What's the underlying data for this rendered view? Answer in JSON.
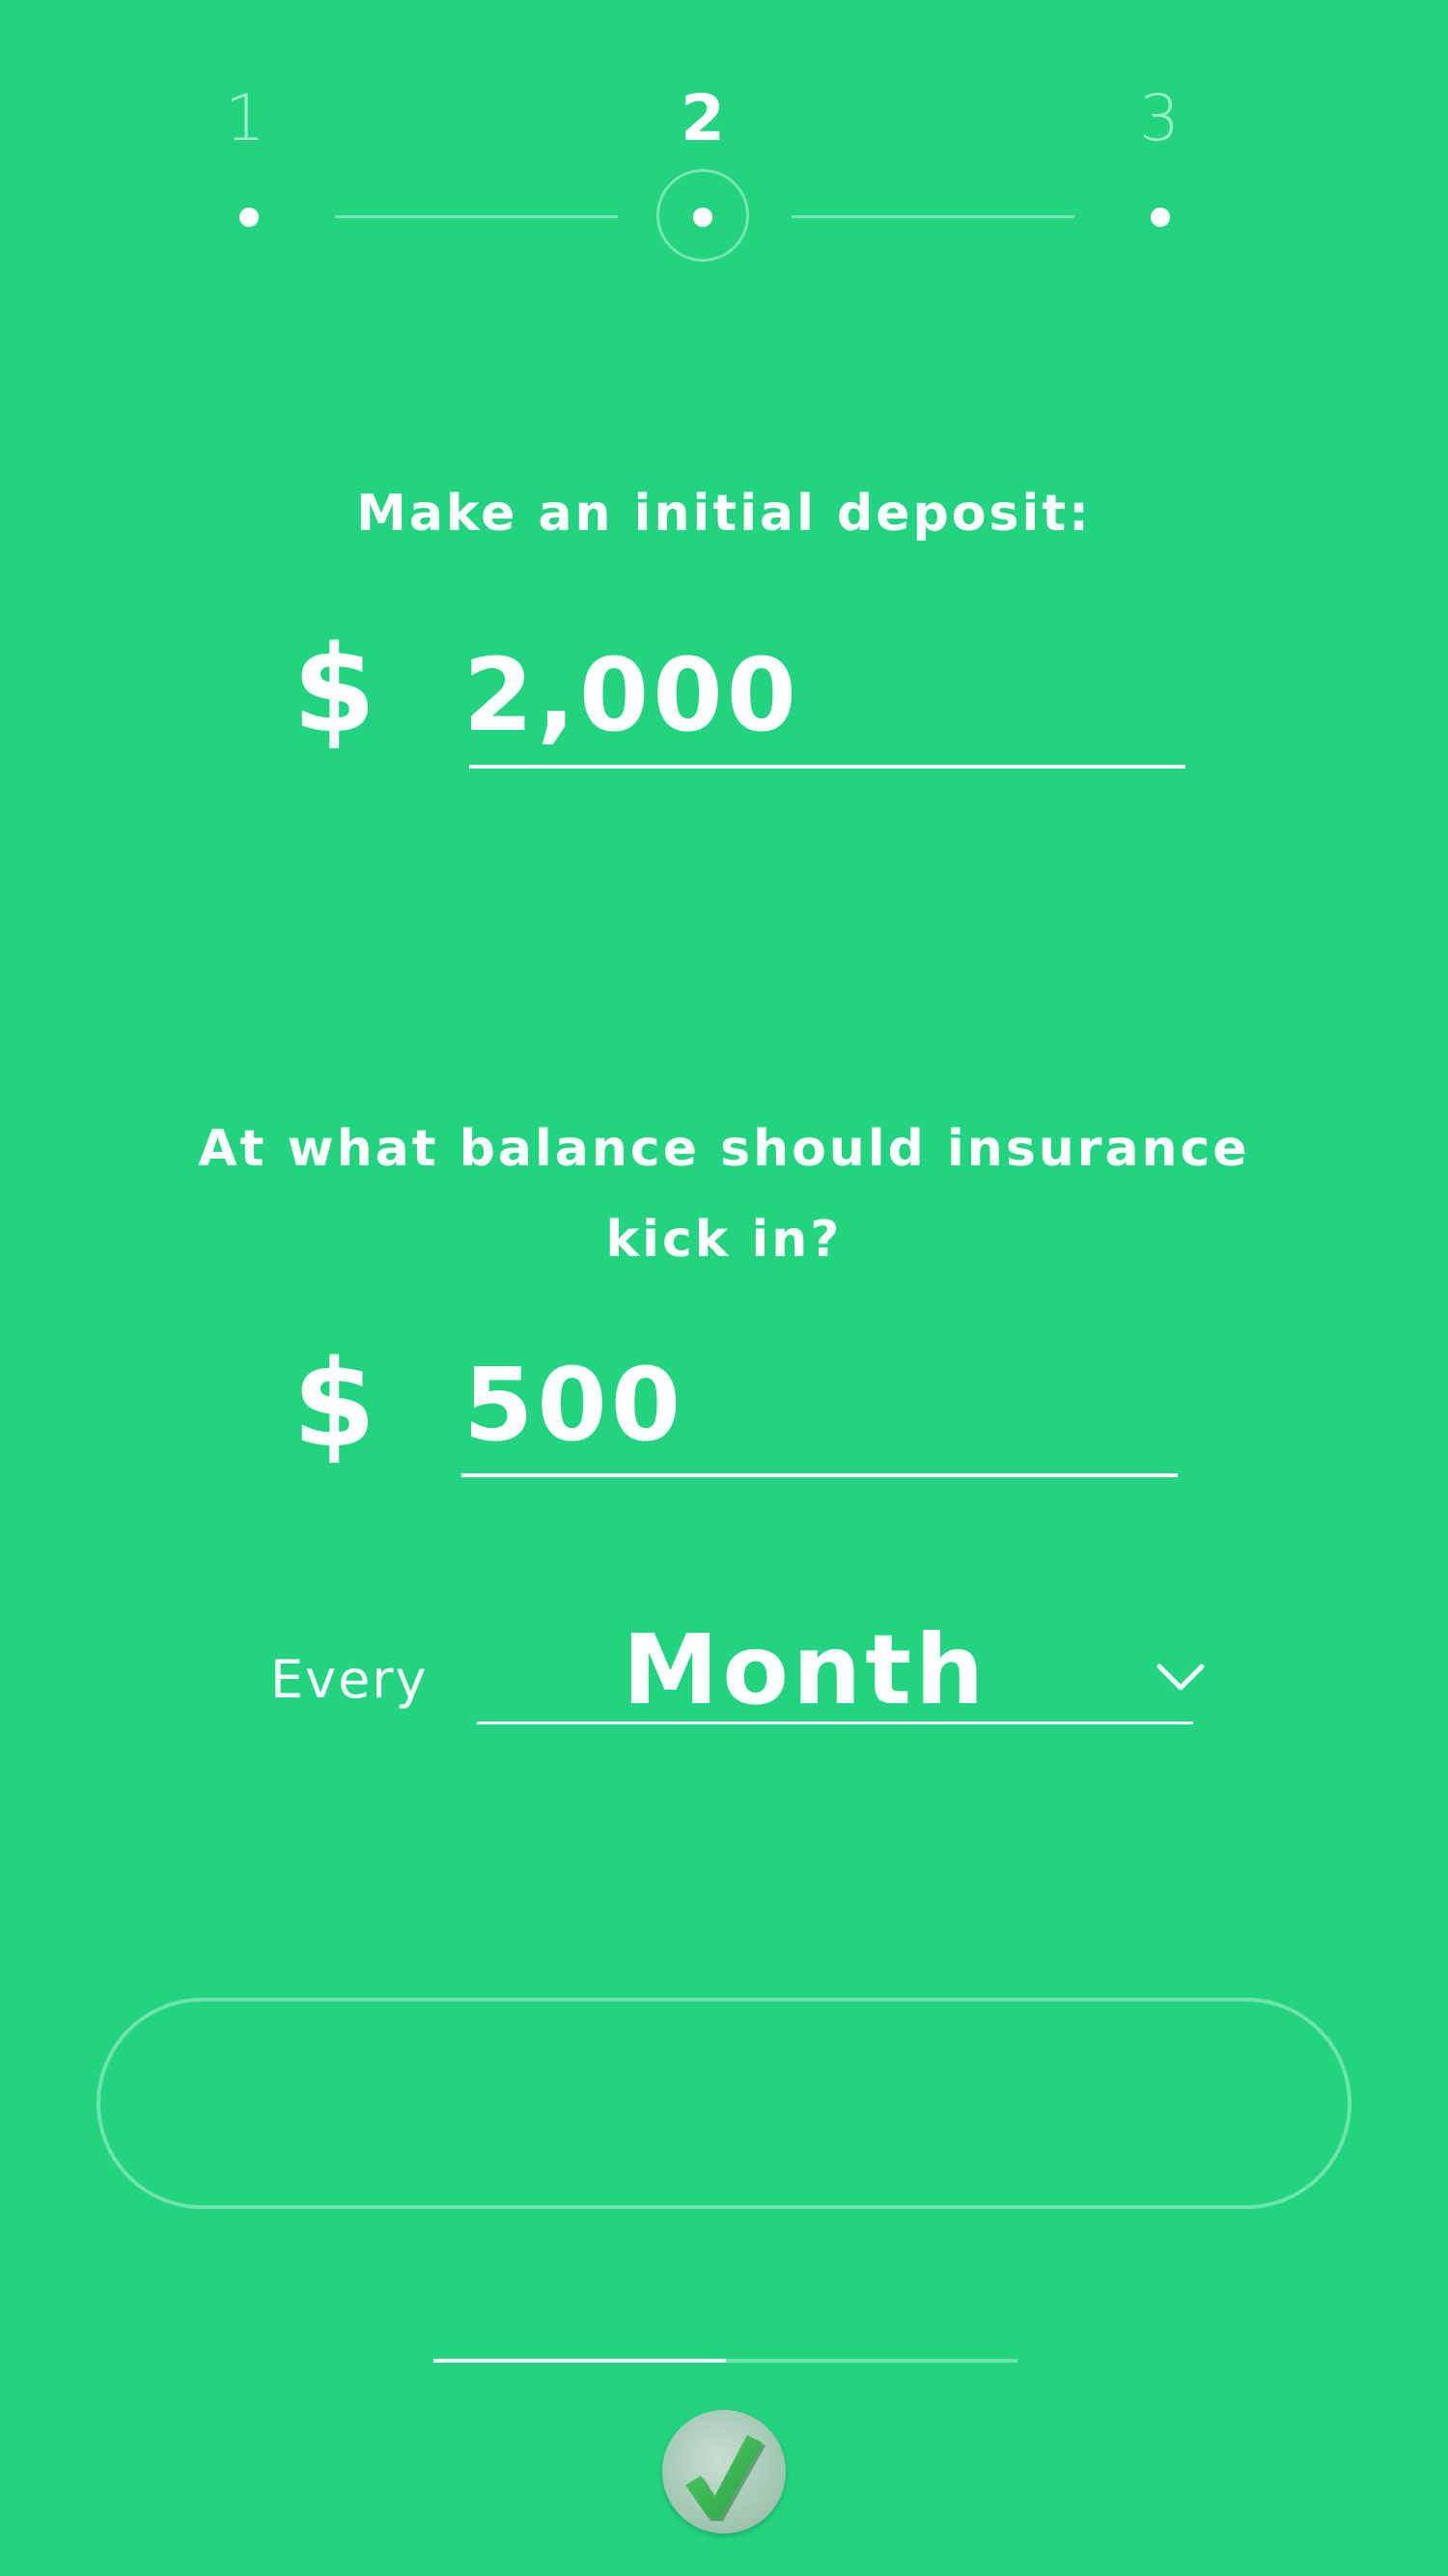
{
  "stepper": {
    "steps": [
      {
        "label": "1",
        "active": false
      },
      {
        "label": "2",
        "active": true
      },
      {
        "label": "3",
        "active": false
      }
    ]
  },
  "deposit": {
    "question": "Make an initial deposit:",
    "currency": "$",
    "value": "2,000"
  },
  "threshold": {
    "question_line1": "At what balance should insurance",
    "question_line2": "kick in?",
    "currency": "$",
    "value": "500"
  },
  "frequency": {
    "label": "Every",
    "selected": "Month"
  },
  "progress": {
    "fraction": 0.5
  },
  "icons": {
    "dropdown": "chevron-down-icon",
    "confirm": "checkmark-icon"
  },
  "colors": {
    "background": "#22d47f",
    "foreground": "#ffffff"
  }
}
